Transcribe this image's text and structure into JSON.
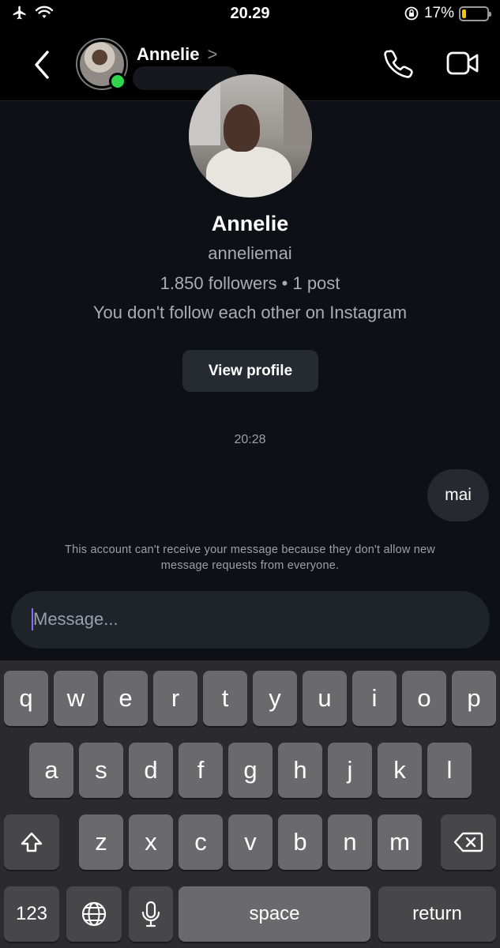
{
  "status_bar": {
    "time": "20.29",
    "battery_percent_label": "17%",
    "battery_level": 0.17,
    "battery_color": "#f5c400",
    "icons": [
      "airplane-icon",
      "wifi-icon",
      "orientation-lock-icon",
      "battery-icon"
    ]
  },
  "header": {
    "name": "Annelie",
    "chevron": ">",
    "online_color": "#2fd64d",
    "icons": [
      "back-icon",
      "phone-icon",
      "video-icon"
    ]
  },
  "profile": {
    "name": "Annelie",
    "username": "anneliemai",
    "stats": "1.850 followers • 1 post",
    "follow_status": "You don't follow each other on Instagram",
    "view_profile_label": "View profile"
  },
  "chat": {
    "timestamp": "20:28",
    "messages": [
      {
        "from": "me",
        "text": "mai"
      }
    ],
    "notice": "This account can't receive your message because they don't allow new message requests from everyone."
  },
  "composer": {
    "placeholder": "Message...",
    "value": ""
  },
  "keyboard": {
    "row1": [
      "q",
      "w",
      "e",
      "r",
      "t",
      "y",
      "u",
      "i",
      "o",
      "p"
    ],
    "row2": [
      "a",
      "s",
      "d",
      "f",
      "g",
      "h",
      "j",
      "k",
      "l"
    ],
    "row3": [
      "z",
      "x",
      "c",
      "v",
      "b",
      "n",
      "m"
    ],
    "numbers_label": "123",
    "space_label": "space",
    "return_label": "return"
  }
}
